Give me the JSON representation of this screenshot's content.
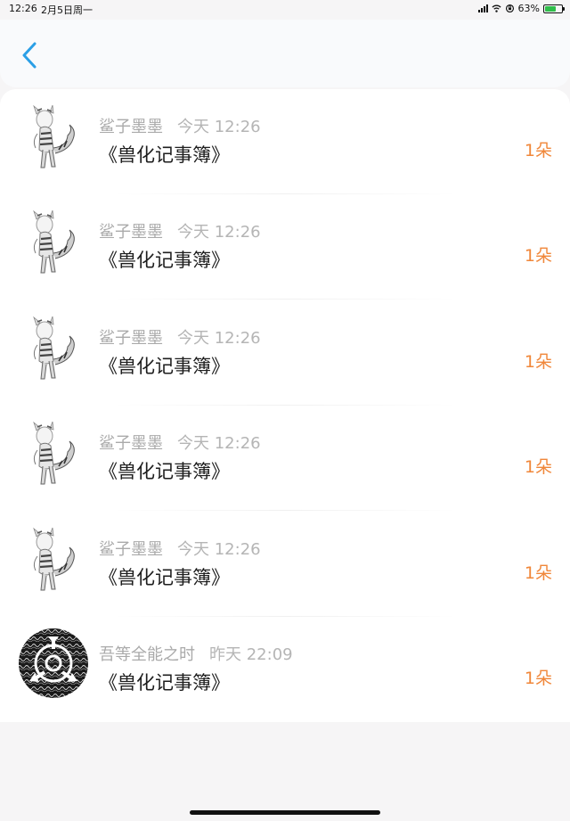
{
  "status_bar": {
    "time": "12:26",
    "date": "2月5日周一",
    "battery": "63%",
    "icons": [
      "signal-icon",
      "wifi-icon",
      "rotation-lock-icon",
      "battery-icon"
    ]
  },
  "header": {
    "back_icon": "chevron-left-icon",
    "accent": "#2b9fe6"
  },
  "colors": {
    "count": "#f0873a",
    "sender": "#aaaaaa",
    "title": "#1e1e1e"
  },
  "items": [
    {
      "sender": "鲨子墨墨",
      "time": "今天 12:26",
      "title": "《兽化记事簿》",
      "count": "1朵",
      "avatar": "tiger-character-avatar"
    },
    {
      "sender": "鲨子墨墨",
      "time": "今天 12:26",
      "title": "《兽化记事簿》",
      "count": "1朵",
      "avatar": "tiger-character-avatar"
    },
    {
      "sender": "鲨子墨墨",
      "time": "今天 12:26",
      "title": "《兽化记事簿》",
      "count": "1朵",
      "avatar": "tiger-character-avatar"
    },
    {
      "sender": "鲨子墨墨",
      "time": "今天 12:26",
      "title": "《兽化记事簿》",
      "count": "1朵",
      "avatar": "tiger-character-avatar"
    },
    {
      "sender": "鲨子墨墨",
      "time": "今天 12:26",
      "title": "《兽化记事簿》",
      "count": "1朵",
      "avatar": "tiger-character-avatar"
    },
    {
      "sender": "吾等全能之时",
      "time": "昨天 22:09",
      "title": "《兽化记事簿》",
      "count": "1朵",
      "avatar": "scp-logo-avatar"
    }
  ]
}
